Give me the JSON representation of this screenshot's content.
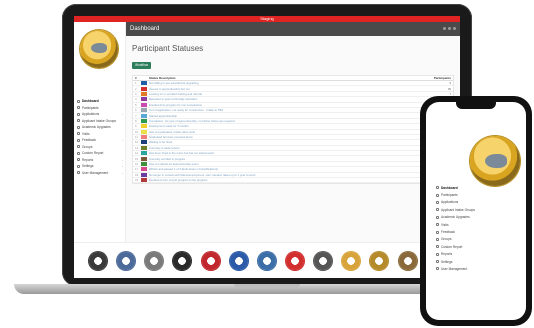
{
  "app": {
    "environment_banner": "Staging",
    "window_title": "Dashboard"
  },
  "sidebar": {
    "items": [
      {
        "label": "Dashboard",
        "active": true,
        "icon": "home-icon"
      },
      {
        "label": "Participants",
        "icon": "users-icon"
      },
      {
        "label": "Applications",
        "icon": "file-icon",
        "has_children": true
      },
      {
        "label": "Applicant Intake Groups",
        "icon": "group-icon"
      },
      {
        "label": "Academic Upgrades",
        "icon": "book-icon"
      },
      {
        "label": "Visits",
        "icon": "calendar-icon"
      },
      {
        "label": "Feedback",
        "icon": "comment-icon",
        "has_children": true
      },
      {
        "label": "Groups",
        "icon": "group-icon"
      },
      {
        "label": "Custom Report",
        "icon": "report-icon"
      },
      {
        "label": "Reports",
        "icon": "chart-icon",
        "has_children": true
      },
      {
        "label": "Settings",
        "icon": "gear-icon",
        "has_children": true
      },
      {
        "label": "User Management",
        "icon": "user-icon",
        "has_children": true
      }
    ]
  },
  "main": {
    "page_title": "Participant Statuses",
    "primary_button": "Workflow",
    "table": {
      "headers": [
        "#",
        "Status Description",
        "Participants"
      ],
      "rows": [
        {
          "num": "1",
          "color": "#1f5fa8",
          "desc": "Not willing to see educational upgrading",
          "count": "9"
        },
        {
          "num": "2",
          "color": "#d22f2f",
          "desc": "Interest in apprenticeship but not",
          "count": "35"
        },
        {
          "num": "3",
          "color": "#e07b24",
          "desc": "Looking for or enrolled training and referral",
          "count": "7"
        },
        {
          "num": "4",
          "color": "#8e3aa0",
          "desc": "Reluctant to pass technically education",
          "count": ""
        },
        {
          "num": "5",
          "color": "#c94ab1",
          "desc": "Enrolled in/to program for non-completions",
          "count": ""
        },
        {
          "num": "6",
          "color": "#9aa6b2",
          "desc": "Out of application, not ready for construction - Intake to TBA",
          "count": ""
        },
        {
          "num": "7",
          "color": "#5aa8d6",
          "desc": "Started apprenticeship",
          "count": ""
        },
        {
          "num": "8",
          "color": "#2e9a4e",
          "desc": "Completion, 1st year of apprenticeship, no further follow-ups required",
          "count": ""
        },
        {
          "num": "9",
          "color": "#f2d02b",
          "desc": "Employment made for 3 months",
          "count": ""
        },
        {
          "num": "10",
          "color": "#e8e04a",
          "desc": "Has not graduated, inside video work",
          "count": ""
        },
        {
          "num": "11",
          "color": "#f07c7c",
          "desc": "Graduated but have personal items",
          "count": ""
        },
        {
          "num": "12",
          "color": "#1d3f7a",
          "desc": "Waiting to be hired",
          "count": ""
        },
        {
          "num": "13",
          "color": "#6e7f2a",
          "desc": "Currently in trade school",
          "count": ""
        },
        {
          "num": "14",
          "color": "#2aa6a0",
          "desc": "Has been hired to the union but has not started work",
          "count": ""
        },
        {
          "num": "15",
          "color": "#7b5a3a",
          "desc": "Currently enrolled in program",
          "count": ""
        },
        {
          "num": "16",
          "color": "#3f8f3f",
          "desc": "Has not started an apprenticeship exam",
          "count": ""
        },
        {
          "num": "17",
          "color": "#d94a8a",
          "desc": "Written and passed 1 of 3 (Exits Exam of Qualifications)",
          "count": ""
        },
        {
          "num": "18",
          "color": "#6a3fa0",
          "desc": "No longer in contact with Matrix/employment, can't needed, takes up to 1 year to send",
          "count": ""
        },
        {
          "num": "19",
          "color": "#b03a3a",
          "desc": "Decided to turn out job program to the program",
          "count": ""
        }
      ]
    }
  },
  "footer": {
    "seals": [
      {
        "name": "seal-1-icon",
        "color": "#3a3a3a"
      },
      {
        "name": "seal-2-icon",
        "color": "#4c6a9a"
      },
      {
        "name": "seal-3-icon",
        "color": "#7a7a7a"
      },
      {
        "name": "seal-4-icon",
        "color": "#2a2a2a"
      },
      {
        "name": "seal-5-icon",
        "color": "#c0282d"
      },
      {
        "name": "seal-6-icon",
        "color": "#2a5aa8"
      },
      {
        "name": "seal-7-icon",
        "color": "#3c6ea8"
      },
      {
        "name": "seal-8-icon",
        "color": "#d22f2f"
      },
      {
        "name": "seal-9-icon",
        "color": "#555555"
      },
      {
        "name": "seal-10-icon",
        "color": "#d8a33a"
      },
      {
        "name": "seal-11-icon",
        "color": "#b58a2a"
      },
      {
        "name": "seal-12-icon",
        "color": "#8a6a3a"
      },
      {
        "name": "seal-13-icon",
        "color": "#2c4a8a"
      }
    ]
  },
  "phone": {
    "items": [
      "Dashboard",
      "Participants",
      "Applications",
      "Applicant Intake Groups",
      "Academic Upgrades",
      "Visits",
      "Feedback",
      "Groups",
      "Custom Report",
      "Reports",
      "Settings",
      "User Management"
    ]
  },
  "theme": {
    "accent": "#2e7d5b",
    "banner": "#e02424",
    "header": "#4a4a4a",
    "link": "#7aa0c0"
  }
}
